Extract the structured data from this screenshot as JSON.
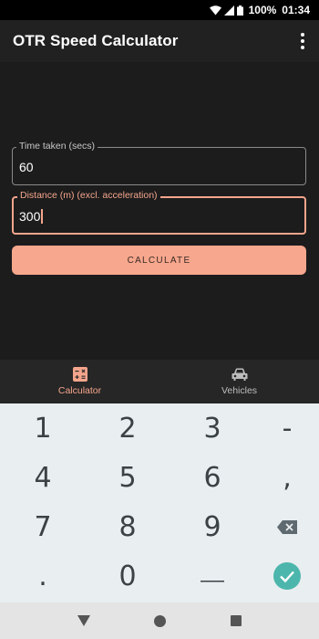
{
  "status": {
    "battery": "100%",
    "time": "01:34"
  },
  "app": {
    "title": "OTR Speed Calculator"
  },
  "form": {
    "time_label": "Time taken (secs)",
    "time_value": "60",
    "distance_label": "Distance (m) (excl. acceleration)",
    "distance_value": "300",
    "calculate_label": "CALCULATE"
  },
  "nav": {
    "items": [
      {
        "label": "Calculator",
        "icon": "calculator-icon",
        "active": true
      },
      {
        "label": "Vehicles",
        "icon": "car-icon",
        "active": false
      }
    ]
  },
  "keyboard": {
    "keys": [
      "1",
      "2",
      "3",
      "-",
      "4",
      "5",
      "6",
      ",",
      "7",
      "8",
      "9",
      "backspace",
      ".",
      "0",
      "_",
      "done"
    ]
  },
  "colors": {
    "accent": "#f4a58c",
    "app_bar": "#212121",
    "keyboard_bg": "#e9eef0",
    "done_key": "#4db6ac"
  }
}
